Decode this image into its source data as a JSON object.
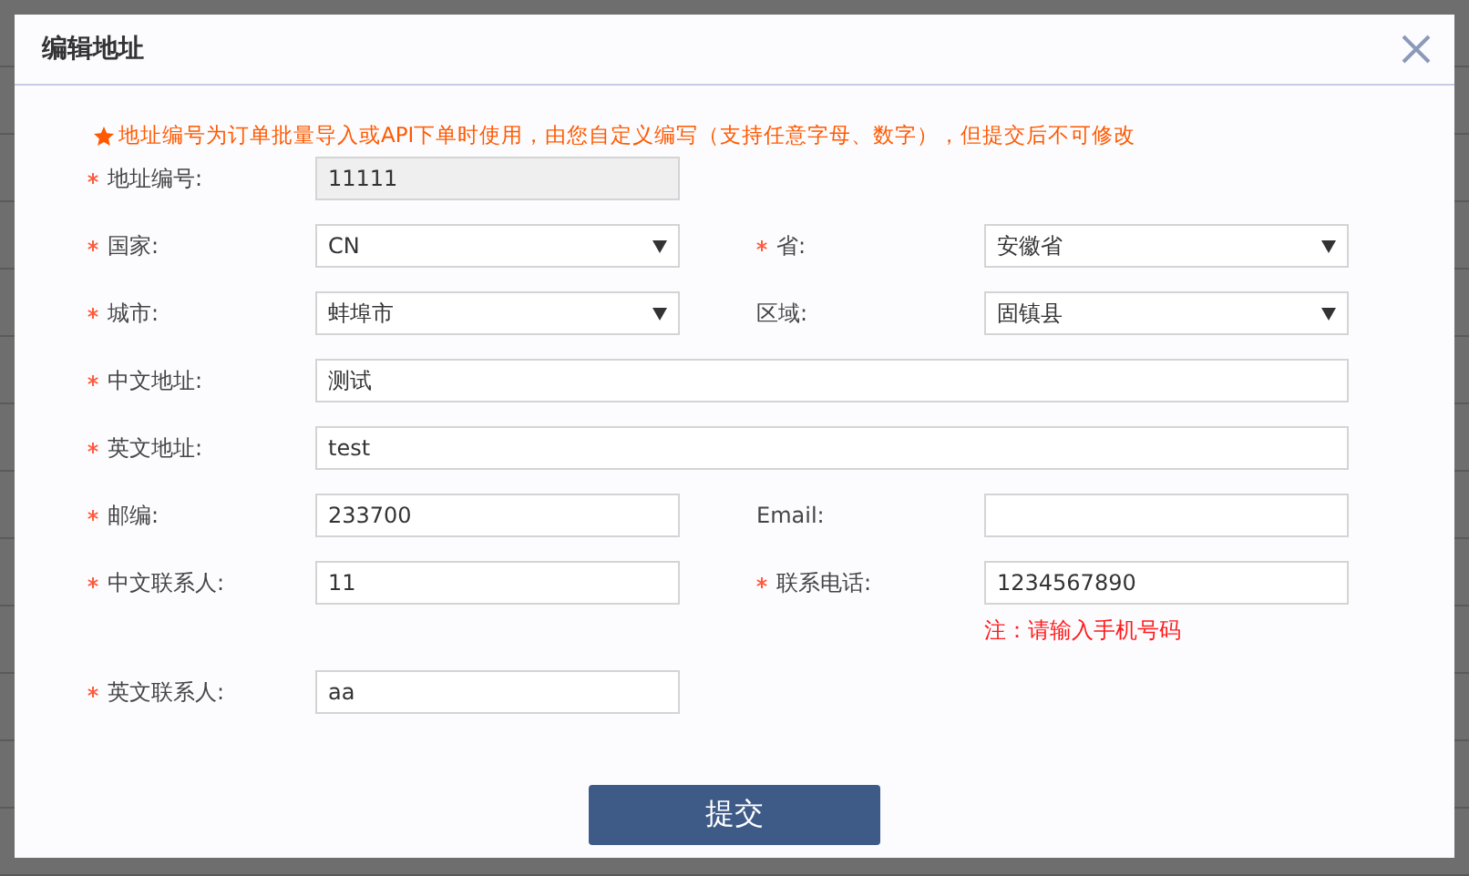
{
  "dialog": {
    "title": "编辑地址",
    "notice": "地址编号为订单批量导入或API下单时使用，由您自定义编写（支持任意字母、数字），但提交后不可修改",
    "rows": [
      [
        {
          "label": "地址编号:",
          "required": true,
          "kind": "readonly",
          "value": "11111"
        }
      ],
      [
        {
          "label": "国家:",
          "required": true,
          "kind": "select",
          "value": "CN"
        },
        {
          "label": "省:",
          "required": true,
          "kind": "select",
          "value": "安徽省"
        }
      ],
      [
        {
          "label": "城市:",
          "required": true,
          "kind": "select",
          "value": "蚌埠市"
        },
        {
          "label": "区域:",
          "required": false,
          "kind": "select",
          "value": "固镇县"
        }
      ],
      [
        {
          "label": "中文地址:",
          "required": true,
          "kind": "wide",
          "value": "测试"
        }
      ],
      [
        {
          "label": "英文地址:",
          "required": true,
          "kind": "wide",
          "value": "test"
        }
      ],
      [
        {
          "label": "邮编:",
          "required": true,
          "kind": "text",
          "value": "233700"
        },
        {
          "label": "Email:",
          "required": false,
          "kind": "text"
        }
      ],
      [
        {
          "label": "中文联系人:",
          "required": true,
          "kind": "text",
          "value": "11"
        },
        {
          "label": "联系电话:",
          "required": true,
          "kind": "text",
          "value": "1234567890",
          "hint": "注：请输入手机号码"
        }
      ],
      [
        {
          "label": "英文联系人:",
          "required": true,
          "kind": "text",
          "value": "aa"
        }
      ]
    ],
    "submit": "提交"
  }
}
